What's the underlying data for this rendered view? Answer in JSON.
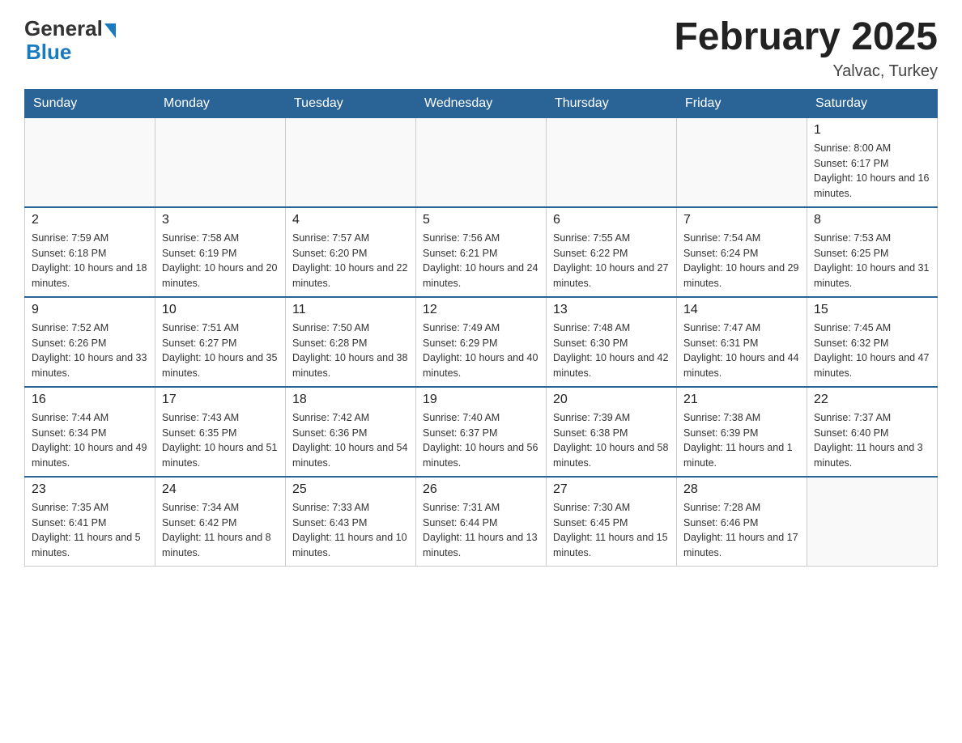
{
  "header": {
    "logo_general": "General",
    "logo_blue": "Blue",
    "month_title": "February 2025",
    "location": "Yalvac, Turkey"
  },
  "days_of_week": [
    "Sunday",
    "Monday",
    "Tuesday",
    "Wednesday",
    "Thursday",
    "Friday",
    "Saturday"
  ],
  "weeks": [
    [
      {
        "day": "",
        "info": ""
      },
      {
        "day": "",
        "info": ""
      },
      {
        "day": "",
        "info": ""
      },
      {
        "day": "",
        "info": ""
      },
      {
        "day": "",
        "info": ""
      },
      {
        "day": "",
        "info": ""
      },
      {
        "day": "1",
        "info": "Sunrise: 8:00 AM\nSunset: 6:17 PM\nDaylight: 10 hours and 16 minutes."
      }
    ],
    [
      {
        "day": "2",
        "info": "Sunrise: 7:59 AM\nSunset: 6:18 PM\nDaylight: 10 hours and 18 minutes."
      },
      {
        "day": "3",
        "info": "Sunrise: 7:58 AM\nSunset: 6:19 PM\nDaylight: 10 hours and 20 minutes."
      },
      {
        "day": "4",
        "info": "Sunrise: 7:57 AM\nSunset: 6:20 PM\nDaylight: 10 hours and 22 minutes."
      },
      {
        "day": "5",
        "info": "Sunrise: 7:56 AM\nSunset: 6:21 PM\nDaylight: 10 hours and 24 minutes."
      },
      {
        "day": "6",
        "info": "Sunrise: 7:55 AM\nSunset: 6:22 PM\nDaylight: 10 hours and 27 minutes."
      },
      {
        "day": "7",
        "info": "Sunrise: 7:54 AM\nSunset: 6:24 PM\nDaylight: 10 hours and 29 minutes."
      },
      {
        "day": "8",
        "info": "Sunrise: 7:53 AM\nSunset: 6:25 PM\nDaylight: 10 hours and 31 minutes."
      }
    ],
    [
      {
        "day": "9",
        "info": "Sunrise: 7:52 AM\nSunset: 6:26 PM\nDaylight: 10 hours and 33 minutes."
      },
      {
        "day": "10",
        "info": "Sunrise: 7:51 AM\nSunset: 6:27 PM\nDaylight: 10 hours and 35 minutes."
      },
      {
        "day": "11",
        "info": "Sunrise: 7:50 AM\nSunset: 6:28 PM\nDaylight: 10 hours and 38 minutes."
      },
      {
        "day": "12",
        "info": "Sunrise: 7:49 AM\nSunset: 6:29 PM\nDaylight: 10 hours and 40 minutes."
      },
      {
        "day": "13",
        "info": "Sunrise: 7:48 AM\nSunset: 6:30 PM\nDaylight: 10 hours and 42 minutes."
      },
      {
        "day": "14",
        "info": "Sunrise: 7:47 AM\nSunset: 6:31 PM\nDaylight: 10 hours and 44 minutes."
      },
      {
        "day": "15",
        "info": "Sunrise: 7:45 AM\nSunset: 6:32 PM\nDaylight: 10 hours and 47 minutes."
      }
    ],
    [
      {
        "day": "16",
        "info": "Sunrise: 7:44 AM\nSunset: 6:34 PM\nDaylight: 10 hours and 49 minutes."
      },
      {
        "day": "17",
        "info": "Sunrise: 7:43 AM\nSunset: 6:35 PM\nDaylight: 10 hours and 51 minutes."
      },
      {
        "day": "18",
        "info": "Sunrise: 7:42 AM\nSunset: 6:36 PM\nDaylight: 10 hours and 54 minutes."
      },
      {
        "day": "19",
        "info": "Sunrise: 7:40 AM\nSunset: 6:37 PM\nDaylight: 10 hours and 56 minutes."
      },
      {
        "day": "20",
        "info": "Sunrise: 7:39 AM\nSunset: 6:38 PM\nDaylight: 10 hours and 58 minutes."
      },
      {
        "day": "21",
        "info": "Sunrise: 7:38 AM\nSunset: 6:39 PM\nDaylight: 11 hours and 1 minute."
      },
      {
        "day": "22",
        "info": "Sunrise: 7:37 AM\nSunset: 6:40 PM\nDaylight: 11 hours and 3 minutes."
      }
    ],
    [
      {
        "day": "23",
        "info": "Sunrise: 7:35 AM\nSunset: 6:41 PM\nDaylight: 11 hours and 5 minutes."
      },
      {
        "day": "24",
        "info": "Sunrise: 7:34 AM\nSunset: 6:42 PM\nDaylight: 11 hours and 8 minutes."
      },
      {
        "day": "25",
        "info": "Sunrise: 7:33 AM\nSunset: 6:43 PM\nDaylight: 11 hours and 10 minutes."
      },
      {
        "day": "26",
        "info": "Sunrise: 7:31 AM\nSunset: 6:44 PM\nDaylight: 11 hours and 13 minutes."
      },
      {
        "day": "27",
        "info": "Sunrise: 7:30 AM\nSunset: 6:45 PM\nDaylight: 11 hours and 15 minutes."
      },
      {
        "day": "28",
        "info": "Sunrise: 7:28 AM\nSunset: 6:46 PM\nDaylight: 11 hours and 17 minutes."
      },
      {
        "day": "",
        "info": ""
      }
    ]
  ]
}
